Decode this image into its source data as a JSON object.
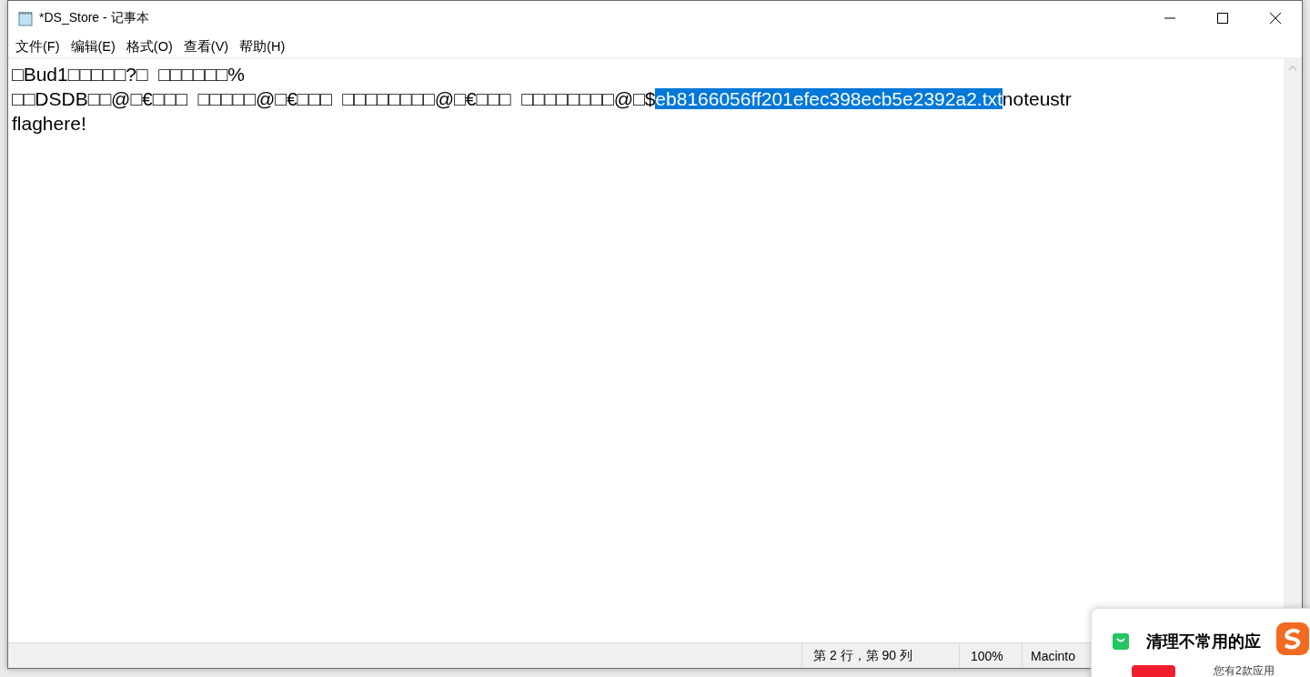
{
  "window": {
    "title": "*DS_Store - 记事本"
  },
  "menu": [
    {
      "label": "文件(F)"
    },
    {
      "label": "编辑(E)"
    },
    {
      "label": "格式(O)"
    },
    {
      "label": "查看(V)"
    },
    {
      "label": "帮助(H)"
    }
  ],
  "editor": {
    "lines": [
      [
        {
          "text": "□Bud1□□□□□?□  □□□□□□%",
          "selected": false
        }
      ],
      [
        {
          "text": "□□DSDB□□@□€□□□  □□□□□@□€□□□  □□□□□□□□@□€□□□  □□□□□□□□@□$",
          "selected": false
        },
        {
          "text": "eb8166056ff201efec398ecb5e2392a2.txt",
          "selected": true
        },
        {
          "text": "noteustr",
          "selected": false
        }
      ],
      [
        {
          "text": "flaghere!",
          "selected": false
        }
      ]
    ]
  },
  "status_bar": {
    "position": "第 2 行，第 90 列",
    "zoom": "100%",
    "line_ending": "Macinto"
  },
  "notification": {
    "title": "清理不常用的应",
    "body": "您有2款应用"
  }
}
